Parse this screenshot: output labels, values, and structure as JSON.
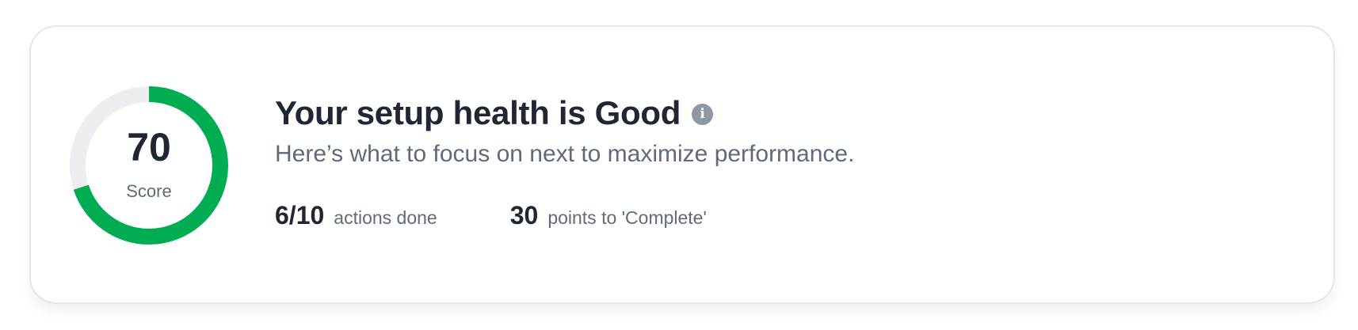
{
  "health_card": {
    "score": {
      "value": "70",
      "label": "Score",
      "progress_fraction": 0.7
    },
    "title": "Your setup health is Good",
    "info_icon": "info-circle-icon",
    "subtitle": "Here’s what to focus on next to maximize performance.",
    "stats": [
      {
        "value": "6/10",
        "label": "actions done"
      },
      {
        "value": "30",
        "label": "points to 'Complete'"
      }
    ]
  },
  "colors": {
    "progress": "#00ad52",
    "track": "#eceef2",
    "title_text": "#1f2733",
    "muted_text": "#5f6b7a"
  }
}
